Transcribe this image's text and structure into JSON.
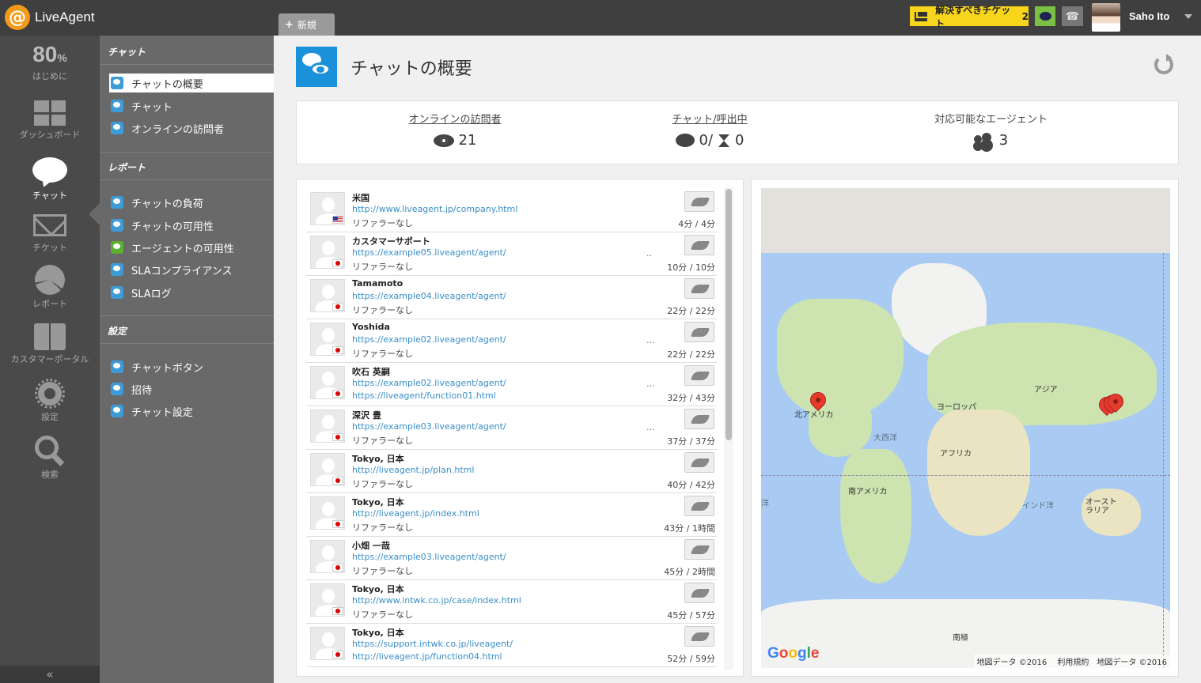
{
  "app": {
    "logo_text": "LiveAgent"
  },
  "topbar": {
    "new_tab": "新規",
    "ticket_label": "解決すべきチケット",
    "ticket_count": "2",
    "user_name": "Saho Ito"
  },
  "rail": {
    "progress_value": "80",
    "progress_unit": "%",
    "progress_label": "はじめに",
    "items": [
      {
        "label": "ダッシュボード"
      },
      {
        "label": "チャット"
      },
      {
        "label": "チケット"
      },
      {
        "label": "レポート"
      },
      {
        "label": "カスタマーポータル"
      },
      {
        "label": "設定"
      },
      {
        "label": "検索"
      }
    ],
    "collapse": "«"
  },
  "submenu": {
    "section_chat": "チャット",
    "chat_items": [
      "チャットの概要",
      "チャット",
      "オンラインの訪問者"
    ],
    "section_report": "レポート",
    "report_items": [
      "チャットの負荷",
      "チャットの可用性",
      "エージェントの可用性",
      "SLAコンプライアンス",
      "SLAログ"
    ],
    "section_settings": "設定",
    "settings_items": [
      "チャットボタン",
      "招待",
      "チャット設定"
    ]
  },
  "page": {
    "title": "チャットの概要"
  },
  "stats": {
    "online_visitors_label": "オンラインの訪問者",
    "online_visitors_value": "21",
    "chats_label": "チャット/呼出中",
    "chats_value": "0/",
    "calls_value": "0",
    "agents_label": "対応可能なエージェント",
    "agents_value": "3"
  },
  "visitors": [
    {
      "name": "米国",
      "url1": "http://www.liveagent.jp/company.html",
      "url2": "",
      "ref": "リファラーなし",
      "time": "4分 / 4分",
      "flag": "us",
      "dots": ""
    },
    {
      "name": "カスタマーサポート",
      "url1": "https://example05.liveagent/agent/",
      "url2": "",
      "ref": "リファラーなし",
      "time": "10分 / 10分",
      "flag": "jp",
      "dots": ".."
    },
    {
      "name": "Tamamoto",
      "url1": "https://example04.liveagent/agent/",
      "url2": "",
      "ref": "リファラーなし",
      "time": "22分 / 22分",
      "flag": "jp",
      "dots": ""
    },
    {
      "name": "Yoshida",
      "url1": "https://example02.liveagent/agent/",
      "url2": "",
      "ref": "リファラーなし",
      "time": "22分 / 22分",
      "flag": "jp",
      "dots": "..."
    },
    {
      "name": "吹石 英嗣",
      "url1": "https://example02.liveagent/agent/",
      "url2": "https://liveagent/function01.html",
      "ref": "",
      "time": "32分 / 43分",
      "flag": "jp",
      "dots": "..."
    },
    {
      "name": "深沢 豊",
      "url1": "https://example03.liveagent/agent/",
      "url2": "",
      "ref": "リファラーなし",
      "time": "37分 / 37分",
      "flag": "jp",
      "dots": "..."
    },
    {
      "name": "Tokyo, 日本",
      "url1": "http://liveagent.jp/plan.html",
      "url2": "",
      "ref": "リファラーなし",
      "time": "40分 / 42分",
      "flag": "jp",
      "dots": ""
    },
    {
      "name": "Tokyo, 日本",
      "url1": "http://liveagent.jp/index.html",
      "url2": "",
      "ref": "リファラーなし",
      "time": "43分 / 1時間",
      "flag": "jp",
      "dots": ""
    },
    {
      "name": "小畑 一哉",
      "url1": "https://example03.liveagent/agent/",
      "url2": "",
      "ref": "リファラーなし",
      "time": "45分 / 2時間",
      "flag": "jp",
      "dots": ""
    },
    {
      "name": "Tokyo, 日本",
      "url1": "http://www.intwk.co.jp/case/index.html",
      "url2": "",
      "ref": "リファラーなし",
      "time": "45分 / 57分",
      "flag": "jp",
      "dots": ""
    },
    {
      "name": "Tokyo, 日本",
      "url1": "https://support.intwk.co.jp/liveagent/",
      "url2": "http://liveagent.jp/function04.html",
      "ref": "",
      "time": "52分 / 59分",
      "flag": "jp",
      "dots": ""
    }
  ],
  "map": {
    "labels": {
      "north_america": "北アメリカ",
      "europe": "ヨーロッパ",
      "asia": "アジア",
      "atlantic": "大西洋",
      "africa": "アフリカ",
      "south_america": "南アメリカ",
      "indian_ocean": "インド洋",
      "australia": "オースト ラリア",
      "antarctica": "南極",
      "west_ocean": "洋"
    },
    "google": "Google",
    "footer": "地図データ ©2016　 利用規約　地図データ ©2016"
  }
}
